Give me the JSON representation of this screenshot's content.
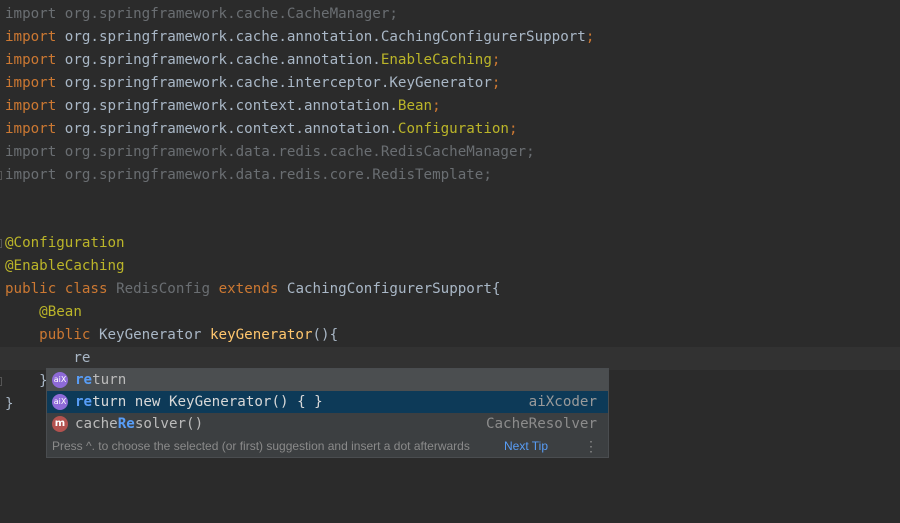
{
  "code": {
    "imports": [
      {
        "kw": "import",
        "pkg": "org.springframework.cache.",
        "cls": "CacheManager",
        "cls_style": "pl",
        "semi": ";",
        "unused": true
      },
      {
        "kw": "import",
        "pkg": "org.springframework.cache.annotation.",
        "cls": "CachingConfigurerSupport",
        "cls_style": "pl",
        "semi": ";",
        "unused": false
      },
      {
        "kw": "import",
        "pkg": "org.springframework.cache.annotation.",
        "cls": "EnableCaching",
        "cls_style": "ann",
        "semi": ";",
        "unused": false
      },
      {
        "kw": "import",
        "pkg": "org.springframework.cache.interceptor.",
        "cls": "KeyGenerator",
        "cls_style": "pl",
        "semi": ";",
        "unused": false
      },
      {
        "kw": "import",
        "pkg": "org.springframework.context.annotation.",
        "cls": "Bean",
        "cls_style": "ann",
        "semi": ";",
        "unused": false
      },
      {
        "kw": "import",
        "pkg": "org.springframework.context.annotation.",
        "cls": "Configuration",
        "cls_style": "ann",
        "semi": ";",
        "unused": false
      },
      {
        "kw": "import",
        "pkg": "org.springframework.data.redis.cache.",
        "cls": "RedisCacheManager",
        "cls_style": "pl",
        "semi": ";",
        "unused": true
      },
      {
        "kw": "import",
        "pkg": "org.springframework.data.redis.core.",
        "cls": "RedisTemplate",
        "cls_style": "pl",
        "semi": ";",
        "unused": true
      }
    ],
    "annotation_configuration": "@Configuration",
    "annotation_enable_caching": "@EnableCaching",
    "class_decl": {
      "kw_public": "public",
      "kw_class": "class",
      "name": "RedisConfig",
      "kw_extends": "extends",
      "parent": "CachingConfigurerSupport",
      "brace": "{"
    },
    "annotation_bean": "@Bean",
    "method_decl": {
      "kw_public": "public",
      "type": "KeyGenerator",
      "name": "keyGenerator",
      "parens": "(){"
    },
    "typed_text": "re",
    "close_method": "}",
    "close_class": "}"
  },
  "completion": {
    "items": [
      {
        "icon": "aiX",
        "match": "re",
        "rest": "turn",
        "tail": ""
      },
      {
        "icon": "aiX",
        "match": "re",
        "rest": "turn new KeyGenerator() { }",
        "tail": "aiXcoder"
      },
      {
        "icon": "m",
        "prefix": "cache",
        "match": "Re",
        "rest": "solver()",
        "tail": "CacheResolver"
      }
    ],
    "tip_text": "Press ^. to choose the selected (or first) suggestion and insert a dot afterwards",
    "next_tip": "Next Tip",
    "more": "⋮"
  }
}
